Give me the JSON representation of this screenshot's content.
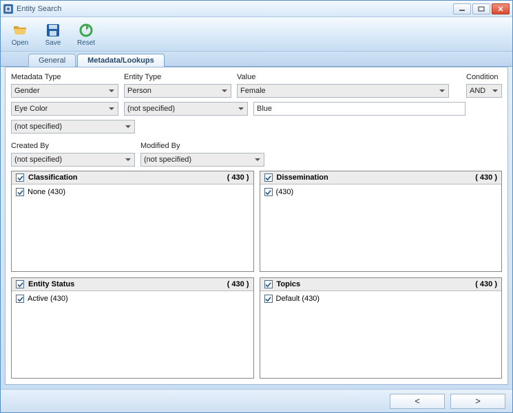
{
  "window": {
    "title": "Entity Search"
  },
  "toolbar": {
    "open": "Open",
    "save": "Save",
    "reset": "Reset"
  },
  "tabs": {
    "general": "General",
    "metadata": "Metadata/Lookups"
  },
  "headers": {
    "metadata_type": "Metadata Type",
    "entity_type": "Entity Type",
    "value": "Value",
    "condition": "Condition",
    "created_by": "Created By",
    "modified_by": "Modified By"
  },
  "rows": [
    {
      "metadata_type": "Gender",
      "entity_type": "Person",
      "value": "Female",
      "value_kind": "select",
      "condition": "AND"
    },
    {
      "metadata_type": "Eye Color",
      "entity_type": "(not specified)",
      "value": "Blue",
      "value_kind": "text",
      "condition": ""
    },
    {
      "metadata_type": "(not specified)",
      "entity_type": "",
      "value": "",
      "value_kind": "",
      "condition": ""
    }
  ],
  "created_by": "(not specified)",
  "modified_by": "(not specified)",
  "groups": {
    "classification": {
      "title": "Classification",
      "count": "( 430 )",
      "items": [
        {
          "label": "None (430)"
        }
      ]
    },
    "dissemination": {
      "title": "Dissemination",
      "count": "( 430 )",
      "items": [
        {
          "label": "(430)"
        }
      ]
    },
    "entity_status": {
      "title": "Entity Status",
      "count": "( 430 )",
      "items": [
        {
          "label": "Active (430)"
        }
      ]
    },
    "topics": {
      "title": "Topics",
      "count": "( 430 )",
      "items": [
        {
          "label": "Default (430)"
        }
      ]
    }
  },
  "nav": {
    "prev": "<",
    "next": ">"
  }
}
